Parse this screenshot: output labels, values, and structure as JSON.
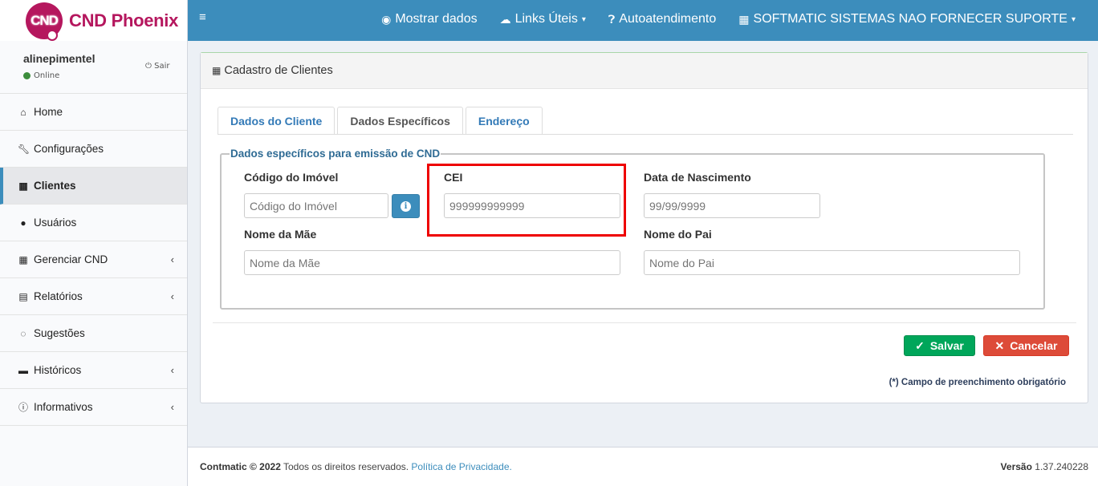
{
  "brand": {
    "logo_text": "CND",
    "name": "CND Phoenix",
    "color": "#b5175e"
  },
  "user": {
    "name": "alinepimentel",
    "status": "Online",
    "logout": "Sair"
  },
  "menu": [
    {
      "label": "Home",
      "icon": "home-icon",
      "glyph": "🏠"
    },
    {
      "label": "Configurações",
      "icon": "wrench-icon",
      "glyph": "🔧"
    },
    {
      "label": "Clientes",
      "icon": "building-icon",
      "glyph": "▦"
    },
    {
      "label": "Usuários",
      "icon": "user-icon",
      "glyph": "👤"
    },
    {
      "label": "Gerenciar CND",
      "icon": "calendar-icon",
      "glyph": "▦"
    },
    {
      "label": "Relatórios",
      "icon": "file-icon",
      "glyph": "▤"
    },
    {
      "label": "Sugestões",
      "icon": "comments-icon",
      "glyph": "💬"
    },
    {
      "label": "Históricos",
      "icon": "archive-icon",
      "glyph": "▬"
    },
    {
      "label": "Informativos",
      "icon": "info-icon",
      "glyph": "ℹ"
    }
  ],
  "topbar": {
    "mostrar_dados": "Mostrar dados",
    "links_uteis": "Links Úteis",
    "autoatendimento": "Autoatendimento",
    "company": "SOFTMATIC SISTEMAS NAO FORNECER SUPORTE"
  },
  "page": {
    "title": "Cadastro de Clientes",
    "tabs": [
      "Dados do Cliente",
      "Dados Específicos",
      "Endereço"
    ],
    "legend": "Dados específicos para emissão de CND",
    "fields": {
      "codigo_imovel": {
        "label": "Código do Imóvel",
        "placeholder": "Código do Imóvel"
      },
      "cei": {
        "label": "CEI",
        "placeholder": "999999999999"
      },
      "data_nascimento": {
        "label": "Data de Nascimento",
        "placeholder": "99/99/9999"
      },
      "nome_mae": {
        "label": "Nome da Mãe",
        "placeholder": "Nome da Mãe"
      },
      "nome_pai": {
        "label": "Nome do Pai",
        "placeholder": "Nome do Pai"
      }
    },
    "save": "Salvar",
    "cancel": "Cancelar",
    "required_note": "(*) Campo de preenchimento obrigatório"
  },
  "footer": {
    "company": "Contmatic © 2022",
    "rights": "Todos os direitos reservados.",
    "privacy": "Política de Privacidade.",
    "version_label": "Versão",
    "version": "1.37.240228"
  },
  "colors": {
    "primary": "#3c8dbc",
    "success": "#00a65a",
    "danger": "#dd4b39",
    "highlight": "#ee0000"
  }
}
